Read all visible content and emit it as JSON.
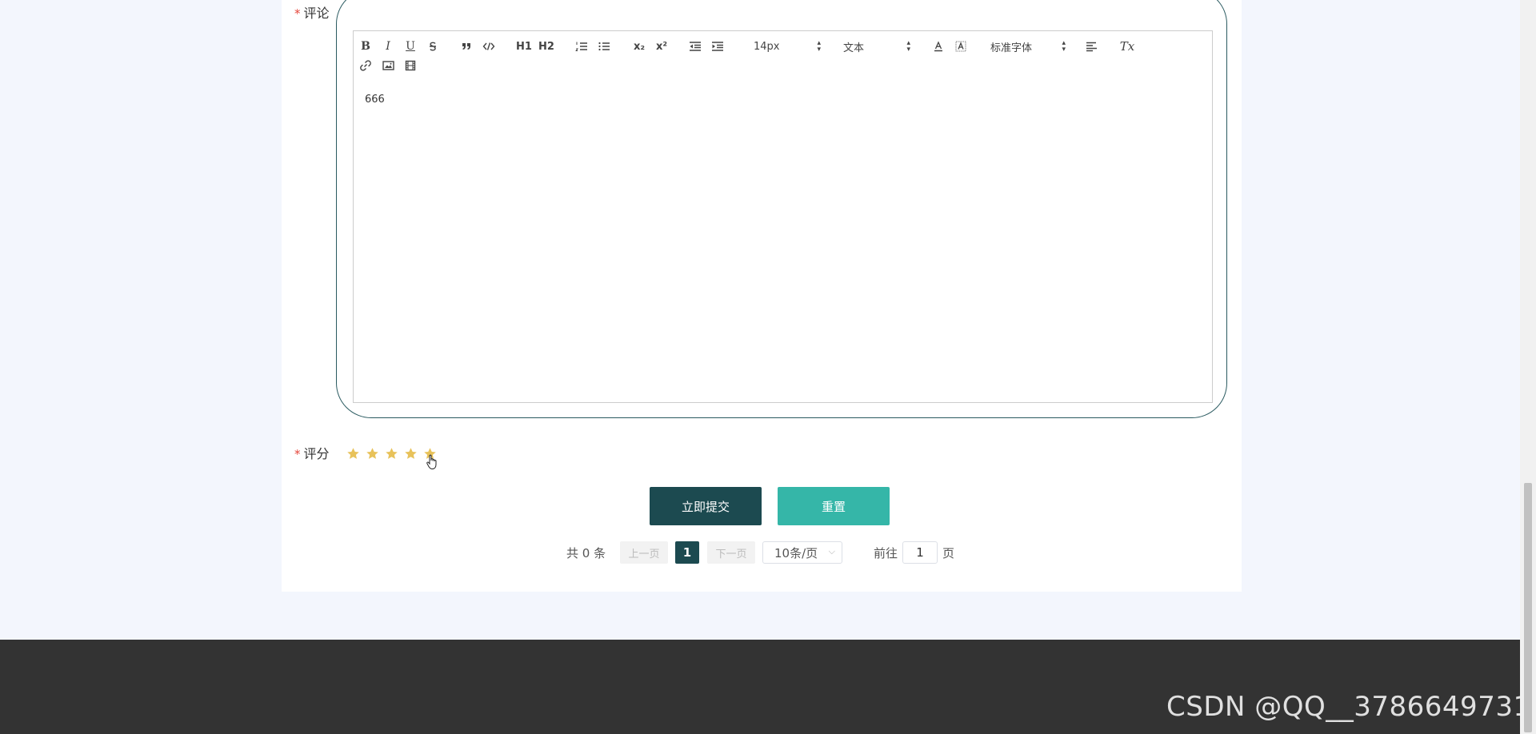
{
  "form": {
    "required_mark": "*",
    "comment_label": "评论",
    "rating_label": "评分",
    "rating_value": 5,
    "rating_max": 5,
    "star_color": "#e8c25a"
  },
  "editor": {
    "content": "666",
    "toolbar": {
      "bold": "B",
      "italic": "I",
      "underline": "U",
      "h1": "H1",
      "h2": "H2",
      "subscript": "x₂",
      "superscript": "x²",
      "font_size": "14px",
      "heading_style": "文本",
      "font_family": "标准字体",
      "clean": "Tx"
    }
  },
  "buttons": {
    "submit": "立即提交",
    "reset": "重置",
    "submit_color": "#1c4a50",
    "reset_color": "#35b6a8"
  },
  "pagination": {
    "total": "共 0 条",
    "prev": "上一页",
    "current_page": "1",
    "next": "下一页",
    "page_size": "10条/页",
    "goto_label": "前往",
    "goto_value": "1",
    "goto_unit": "页"
  },
  "footer": {
    "watermark": "CSDN @QQ__3786649731"
  }
}
